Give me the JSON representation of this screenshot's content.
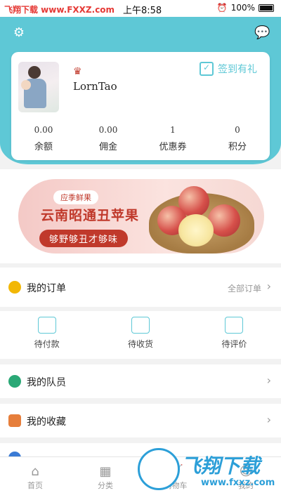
{
  "status_bar": {
    "watermark_text": "飞翔下载 www.FXXZ.com",
    "time": "上午8:58",
    "battery": "100%"
  },
  "header": {
    "settings_icon": "gear-icon",
    "message_icon": "chat-icon",
    "color": "#5ec8d6"
  },
  "profile": {
    "username": "LornTao",
    "checkin_label": "签到有礼",
    "stats": [
      {
        "value": "0.00",
        "label": "余额"
      },
      {
        "value": "0.00",
        "label": "佣金"
      },
      {
        "value": "1",
        "label": "优惠券"
      },
      {
        "value": "0",
        "label": "积分"
      }
    ]
  },
  "banner": {
    "tag": "应季鲜果",
    "title": "云南昭通丑苹果",
    "subtitle": "够野够丑才够味"
  },
  "orders": {
    "title": "我的订单",
    "all_label": "全部订单",
    "items": [
      {
        "label": "待付款",
        "icon": "wallet-icon"
      },
      {
        "label": "待收货",
        "icon": "truck-icon"
      },
      {
        "label": "待评价",
        "icon": "review-icon"
      }
    ]
  },
  "menu": [
    {
      "label": "我的队员",
      "icon": "team-icon",
      "color": "#2aa876"
    },
    {
      "label": "我的收藏",
      "icon": "favorite-icon",
      "color": "#e67e3b"
    }
  ],
  "tabbar": {
    "items": [
      {
        "label": "首页",
        "icon": "home-icon"
      },
      {
        "label": "分类",
        "icon": "category-icon"
      },
      {
        "label": "购物车",
        "icon": "cart-icon"
      },
      {
        "label": "我的",
        "icon": "user-icon"
      }
    ]
  },
  "watermark": {
    "text": "飞翔下载",
    "url": "www.fxxz.com"
  }
}
